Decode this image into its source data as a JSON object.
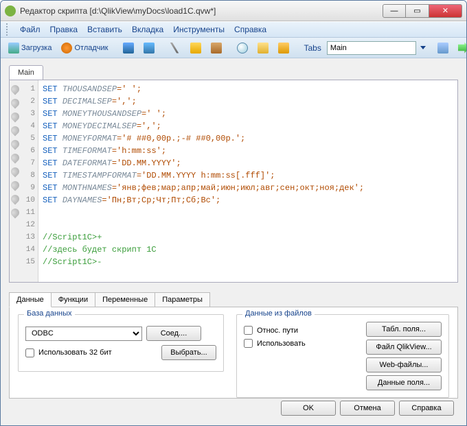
{
  "window": {
    "title": "Редактор скрипта [d:\\QlikView\\myDocs\\load1C.qvw*]"
  },
  "menu": {
    "file": "Файл",
    "edit": "Правка",
    "insert": "Вставить",
    "tab": "Вкладка",
    "tools": "Инструменты",
    "help": "Справка"
  },
  "toolbar": {
    "load": "Загрузка",
    "debug": "Отладчик",
    "tabs_label": "Tabs",
    "tabs_value": "Main"
  },
  "editor": {
    "tab_main": "Main",
    "lines": [
      {
        "n": "1",
        "kw": "SET",
        "var": "THOUSANDSEP",
        "rest": "=' ';"
      },
      {
        "n": "2",
        "kw": "SET",
        "var": "DECIMALSEP",
        "rest": "=',';"
      },
      {
        "n": "3",
        "kw": "SET",
        "var": "MONEYTHOUSANDSEP",
        "rest": "=' ';"
      },
      {
        "n": "4",
        "kw": "SET",
        "var": "MONEYDECIMALSEP",
        "rest": "=',';"
      },
      {
        "n": "5",
        "kw": "SET",
        "var": "MONEYFORMAT",
        "rest": "='# ##0,00р.;-# ##0,00р.';"
      },
      {
        "n": "6",
        "kw": "SET",
        "var": "TIMEFORMAT",
        "rest": "='h:mm:ss';"
      },
      {
        "n": "7",
        "kw": "SET",
        "var": "DATEFORMAT",
        "rest": "='DD.MM.YYYY';"
      },
      {
        "n": "8",
        "kw": "SET",
        "var": "TIMESTAMPFORMAT",
        "rest": "='DD.MM.YYYY h:mm:ss[.fff]';"
      },
      {
        "n": "9",
        "kw": "SET",
        "var": "MONTHNAMES",
        "rest": "='янв;фев;мар;апр;май;июн;июл;авг;сен;окт;ноя;дек';"
      },
      {
        "n": "10",
        "kw": "SET",
        "var": "DAYNAMES",
        "rest": "='Пн;Вт;Ср;Чт;Пт;Сб;Вс';"
      }
    ],
    "blank1": "11",
    "blank2": "12",
    "cmt1_n": "13",
    "cmt1": "//Script1C>+",
    "cmt2_n": "14",
    "cmt2": "//здесь будет скрипт 1С",
    "cmt3_n": "15",
    "cmt3": "//Script1C>-"
  },
  "bottom_tabs": {
    "data": "Данные",
    "functions": "Функции",
    "variables": "Переменные",
    "parameters": "Параметры"
  },
  "db_panel": {
    "db_legend": "База данных",
    "db_type": "ODBC",
    "connect": "Соед....",
    "force32": "Использовать 32 бит",
    "select": "Выбрать...",
    "files_legend": "Данные из файлов",
    "rel_paths": "Относ. пути",
    "use": "Использовать",
    "table_fields": "Табл. поля...",
    "qv_file": "Файл QlikView...",
    "web_files": "Web-файлы...",
    "data_fields": "Данные поля..."
  },
  "footer": {
    "ok": "OK",
    "cancel": "Отмена",
    "help": "Справка"
  }
}
